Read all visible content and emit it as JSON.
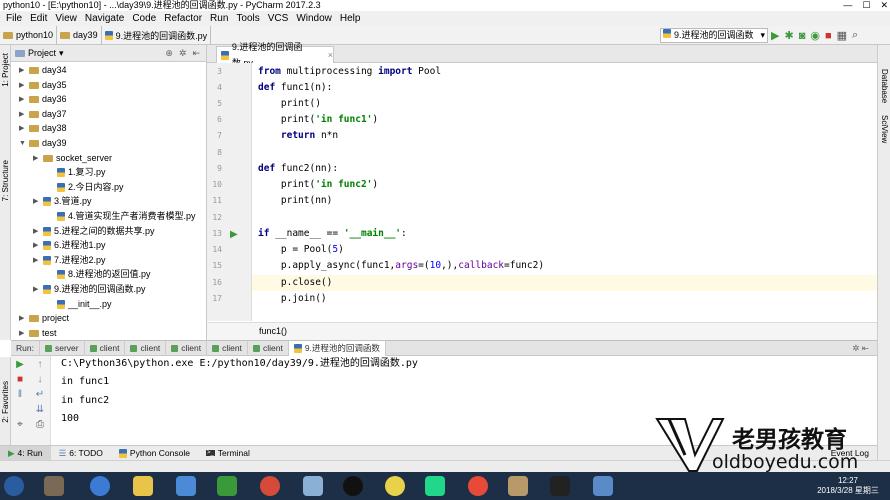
{
  "window": {
    "title": "python10 - [E:\\python10] - ...\\day39\\9.进程池的回调函数.py - PyCharm 2017.2.3",
    "controls": [
      "—",
      "☐",
      "✕"
    ]
  },
  "menu": [
    "File",
    "Edit",
    "View",
    "Navigate",
    "Code",
    "Refactor",
    "Run",
    "Tools",
    "VCS",
    "Window",
    "Help"
  ],
  "breadcrumb": [
    "python10",
    "day39",
    "9.进程池的回调函数.py"
  ],
  "run_config": "9.进程池的回调函数",
  "project_panel": {
    "title": "Project",
    "tree": [
      {
        "label": "day34",
        "type": "folder",
        "indent": 1,
        "arrow": "▶"
      },
      {
        "label": "day35",
        "type": "folder",
        "indent": 1,
        "arrow": "▶"
      },
      {
        "label": "day36",
        "type": "folder",
        "indent": 1,
        "arrow": "▶"
      },
      {
        "label": "day37",
        "type": "folder",
        "indent": 1,
        "arrow": "▶"
      },
      {
        "label": "day38",
        "type": "folder",
        "indent": 1,
        "arrow": "▶"
      },
      {
        "label": "day39",
        "type": "folder",
        "indent": 1,
        "arrow": "▼"
      },
      {
        "label": "socket_server",
        "type": "folder",
        "indent": 2,
        "arrow": "▶"
      },
      {
        "label": "1.复习.py",
        "type": "py",
        "indent": 3,
        "arrow": ""
      },
      {
        "label": "2.今日内容.py",
        "type": "py",
        "indent": 3,
        "arrow": ""
      },
      {
        "label": "3.管道.py",
        "type": "py",
        "indent": 2,
        "arrow": "▶"
      },
      {
        "label": "4.管道实现生产者消费者模型.py",
        "type": "py",
        "indent": 3,
        "arrow": ""
      },
      {
        "label": "5.进程之间的数据共享.py",
        "type": "py",
        "indent": 2,
        "arrow": "▶"
      },
      {
        "label": "6.进程池1.py",
        "type": "py",
        "indent": 2,
        "arrow": "▶"
      },
      {
        "label": "7.进程池2.py",
        "type": "py",
        "indent": 2,
        "arrow": "▶"
      },
      {
        "label": "8.进程池的返回值.py",
        "type": "py",
        "indent": 3,
        "arrow": ""
      },
      {
        "label": "9.进程池的回调函数.py",
        "type": "py",
        "indent": 2,
        "arrow": "▶"
      },
      {
        "label": "__init__.py",
        "type": "py",
        "indent": 3,
        "arrow": ""
      },
      {
        "label": "project",
        "type": "folder",
        "indent": 1,
        "arrow": "▶"
      },
      {
        "label": "test",
        "type": "folder",
        "indent": 1,
        "arrow": "▶"
      }
    ]
  },
  "left_tool_labels": [
    "1: Project",
    "7: Structure"
  ],
  "left_tool_labels_bottom": [
    "2: Favorites"
  ],
  "right_tool_labels": [
    "Database",
    "SciView"
  ],
  "editor": {
    "tab": "9.进程池的回调函数.py",
    "line_numbers": [
      "3",
      "4",
      "5",
      "6",
      "7",
      "8",
      "9",
      "10",
      "11",
      "12",
      "13",
      "14",
      "15",
      "16",
      "17"
    ],
    "breadcrumb": "func1()"
  },
  "run_panel": {
    "label": "Run:",
    "tabs": [
      "server",
      "client",
      "client",
      "client",
      "client",
      "client",
      "9.进程池的回调函数"
    ],
    "console": [
      "C:\\Python36\\python.exe E:/python10/day39/9.进程池的回调函数.py",
      "in func1",
      "in func2",
      "100"
    ]
  },
  "bottom_tabs": [
    "4: Run",
    "6: TODO",
    "Python Console",
    "Terminal"
  ],
  "event_log": "Event Log",
  "watermark": {
    "cn": "老男孩教育",
    "url": "oldboyedu.com"
  },
  "clock": {
    "time": "12:27",
    "date": "2018/3/28 星期三"
  },
  "colors": {
    "keyword": "#000080",
    "string": "#008000",
    "kwarg": "#660099",
    "number": "#0000ff"
  }
}
